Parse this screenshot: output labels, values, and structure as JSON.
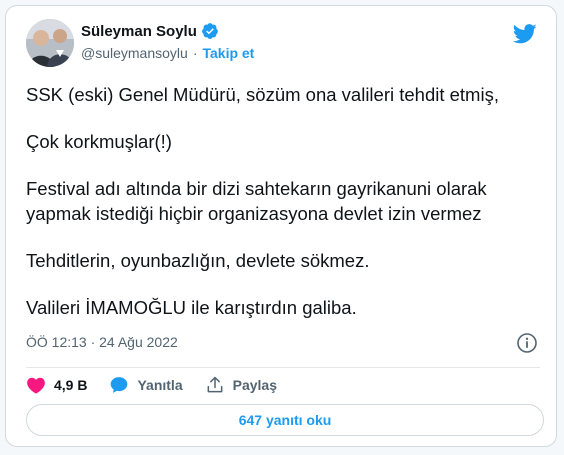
{
  "user": {
    "display_name": "Süleyman Soylu",
    "handle": "@suleymansoylu",
    "separator": "·",
    "follow_label": "Takip et",
    "verified": true
  },
  "tweet": {
    "lines": [
      "SSK (eski) Genel Müdürü, sözüm ona valileri tehdit etmiş,",
      "Çok korkmuşlar(!)",
      "Festival adı altında bir dizi sahtekarın gayrikanuni olarak\nyapmak istediği hiçbir organizasyona devlet izin vermez",
      "Tehditlerin, oyunbazlığın, devlete sökmez.",
      "Valileri İMAMOĞLU ile karıştırdın galiba."
    ],
    "timestamp": "ÖÖ 12:13 · 24 Ağu 2022"
  },
  "actions": {
    "like_count": "4,9 B",
    "reply_label": "Yanıtla",
    "share_label": "Paylaş"
  },
  "replies_button": "647 yanıtı oku",
  "colors": {
    "accent": "#1d9bf0",
    "like": "#f91880",
    "text": "#0f1419",
    "secondary": "#536471"
  },
  "icons": [
    "verified-badge-icon",
    "twitter-logo-icon",
    "info-icon",
    "heart-icon",
    "reply-bubble-icon",
    "share-icon"
  ]
}
